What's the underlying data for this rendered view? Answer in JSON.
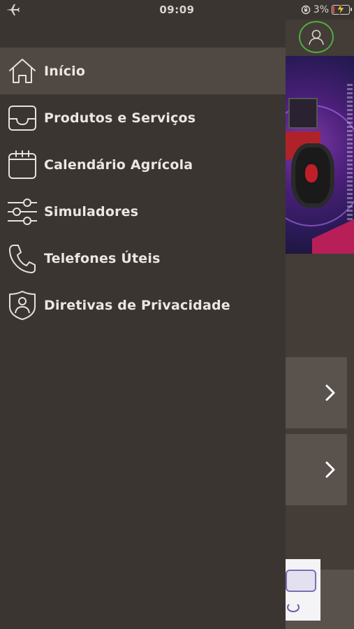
{
  "status_bar": {
    "time": "09:09",
    "battery_percent": "3%",
    "battery_level": 0.03,
    "icons": [
      "airplane-icon",
      "rotation-lock-icon",
      "battery-icon",
      "charging-bolt-icon"
    ]
  },
  "header": {
    "profile_icon": "user-icon",
    "accent_color": "#4fae3d"
  },
  "drawer": {
    "items": [
      {
        "label": "Início",
        "icon": "home-icon",
        "active": true
      },
      {
        "label": "Produtos e Serviços",
        "icon": "inbox-tray-icon",
        "active": false
      },
      {
        "label": "Calendário Agrícola",
        "icon": "calendar-icon",
        "active": false
      },
      {
        "label": "Simuladores",
        "icon": "sliders-icon",
        "active": false
      },
      {
        "label": "Telefones Úteis",
        "icon": "phone-icon",
        "active": false
      },
      {
        "label": "Diretivas de Privacidade",
        "icon": "privacy-shield-icon",
        "active": false
      }
    ]
  },
  "background_page": {
    "cards": [
      {
        "icon": "chevron-right-icon"
      },
      {
        "icon": "chevron-right-icon"
      }
    ]
  }
}
